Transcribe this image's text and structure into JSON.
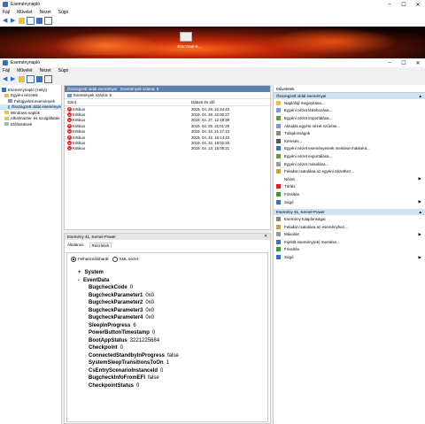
{
  "back_window": {
    "title": "Eseménynapló",
    "menu": [
      "Fájl",
      "Művelet",
      "Nézet",
      "Súgó"
    ],
    "banner_text": "4k6c7eab-8..."
  },
  "window": {
    "title": "Eseménynapló",
    "menu": [
      "Fájl",
      "Művelet",
      "Nézet",
      "Súgó"
    ]
  },
  "tree": {
    "items": [
      {
        "label": "Eseménynapló (Helyi)",
        "indent": 0
      },
      {
        "label": "Egyéni nézetek",
        "indent": 1
      },
      {
        "label": "Felügyeleti események",
        "indent": 2
      },
      {
        "label": "Összegzett oldal eseményei",
        "indent": 2
      },
      {
        "label": "Windows-naplók",
        "indent": 1
      },
      {
        "label": "Alkalmazás- és szolgáltatás",
        "indent": 1
      },
      {
        "label": "Előfizetések",
        "indent": 1
      }
    ]
  },
  "events": {
    "header_title": "Összegzett oldal eseményei",
    "header_count": "Események száma: 9",
    "subheader": "Események száma: 9",
    "col_level": "Szint",
    "col_date": "Dátum és idő",
    "rows": [
      {
        "level": "Kritikus",
        "date": "2019. 04. 28. 22:44:43"
      },
      {
        "level": "Kritikus",
        "date": "2019. 04. 28. 22:00:27"
      },
      {
        "level": "Kritikus",
        "date": "2019. 04. 27. 12:18:38"
      },
      {
        "level": "Kritikus",
        "date": "2019. 04. 25. 21:01:29"
      },
      {
        "level": "Kritikus",
        "date": "2019. 04. 22. 21:17:13"
      },
      {
        "level": "Kritikus",
        "date": "2019. 04. 22. 16:14:43"
      },
      {
        "level": "Kritikus",
        "date": "2019. 04. 22. 19:02:26"
      },
      {
        "level": "Kritikus",
        "date": "2019. 04. 13. 15:08:21"
      }
    ]
  },
  "detail": {
    "title": "Esemény 41, Kernel-Power",
    "tab_general": "Általános",
    "tab_details": "Részletek",
    "radio_friendly": "Felhasználóbarát",
    "radio_xml": "XML nézet",
    "system_label": "System",
    "eventdata_label": "EventData",
    "fields": [
      {
        "name": "BugcheckCode",
        "value": "0"
      },
      {
        "name": "BugcheckParameter1",
        "value": "0x0"
      },
      {
        "name": "BugcheckParameter2",
        "value": "0x0"
      },
      {
        "name": "BugcheckParameter3",
        "value": "0x0"
      },
      {
        "name": "BugcheckParameter4",
        "value": "0x0"
      },
      {
        "name": "SleepInProgress",
        "value": "6"
      },
      {
        "name": "PowerButtonTimestamp",
        "value": "0"
      },
      {
        "name": "BootAppStatus",
        "value": "3221225684"
      },
      {
        "name": "Checkpoint",
        "value": "0"
      },
      {
        "name": "ConnectedStandbyInProgress",
        "value": "false"
      },
      {
        "name": "SystemSleepTransitionsToOn",
        "value": "1"
      },
      {
        "name": "CsEntryScenarioInstanceId",
        "value": "0"
      },
      {
        "name": "BugcheckInfoFromEFI",
        "value": "false"
      },
      {
        "name": "CheckpointStatus",
        "value": "0"
      }
    ]
  },
  "actions": {
    "title": "Műveletek",
    "section1": "Összegzett oldal eseményei",
    "items1": [
      {
        "label": "Naplófájl megnyitása...",
        "icon": "folder-icon"
      },
      {
        "label": "Egyéni nézet létrehozása...",
        "icon": "filter-icon"
      },
      {
        "label": "Egyéni nézet importálása...",
        "icon": "import-icon"
      },
      {
        "label": "Aktuális egyéni nézet szűrése...",
        "icon": "filter-icon"
      },
      {
        "label": "Tulajdonságok",
        "icon": "properties-icon"
      },
      {
        "label": "Keresés...",
        "icon": "find-icon"
      },
      {
        "label": "Egyéni nézet eseményeinek mentése másként...",
        "icon": "save-icon"
      },
      {
        "label": "Egyéni nézet exportálása...",
        "icon": "export-icon"
      },
      {
        "label": "Egyéni nézet másolása...",
        "icon": "copy-icon"
      },
      {
        "label": "Feladat csatolása az egyéni nézethez...",
        "icon": "task-icon"
      },
      {
        "label": "Nézet",
        "icon": "view-icon",
        "arrow": true
      },
      {
        "label": "Törlés",
        "icon": "delete-icon"
      },
      {
        "label": "Frissítés",
        "icon": "refresh-icon"
      },
      {
        "label": "Súgó",
        "icon": "help-icon",
        "arrow": true
      }
    ],
    "section2": "Esemény 41, Kernel-Power",
    "items2": [
      {
        "label": "Esemény tulajdonságai",
        "icon": "properties-icon"
      },
      {
        "label": "Feladat csatolása az eseményhez...",
        "icon": "task-icon"
      },
      {
        "label": "Másolás",
        "icon": "copy-icon",
        "arrow": true
      },
      {
        "label": "Kijelölt esemény(ek) mentése...",
        "icon": "save-icon"
      },
      {
        "label": "Frissítés",
        "icon": "refresh-icon"
      },
      {
        "label": "Súgó",
        "icon": "help-icon",
        "arrow": true
      }
    ]
  },
  "colors": {
    "accent": "#cfe2f6",
    "error": "#d22222",
    "selection": "#cce8ff"
  }
}
